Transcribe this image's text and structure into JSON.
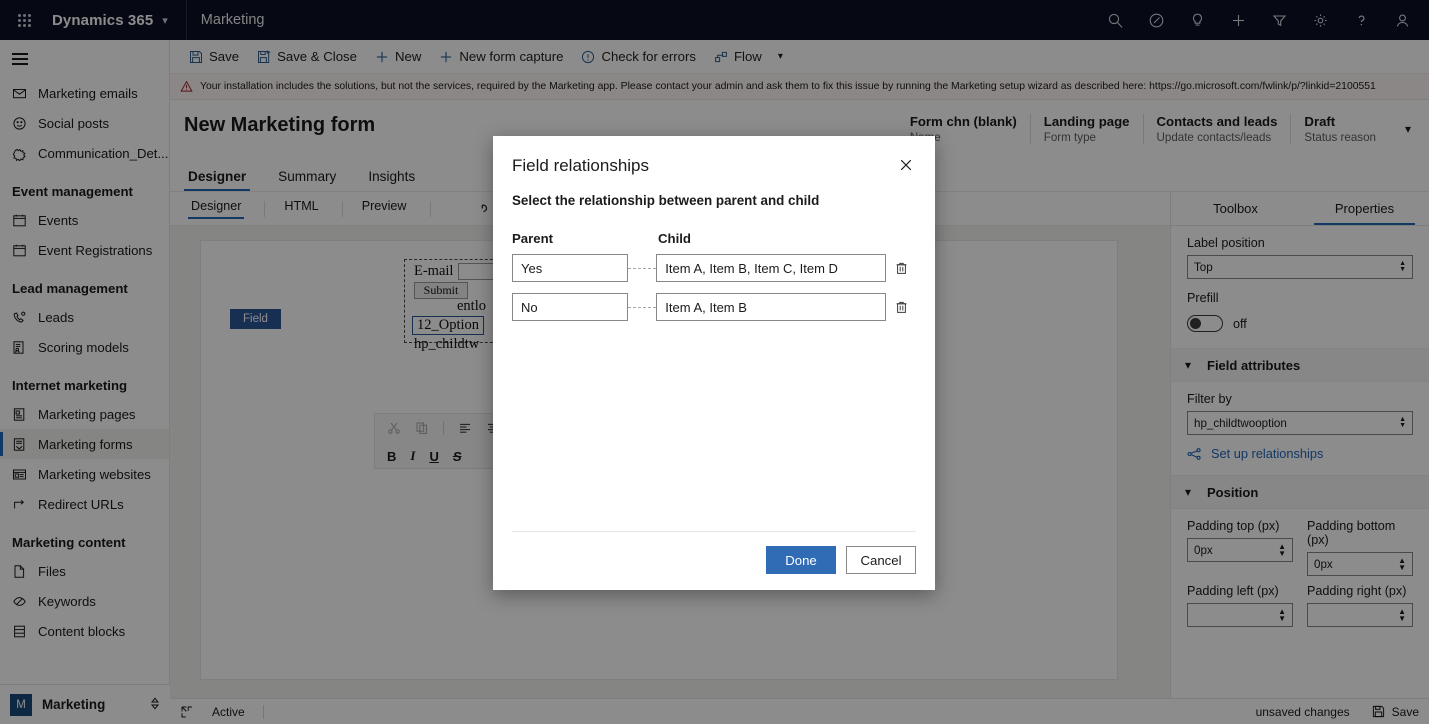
{
  "topbar": {
    "waffle_label": "app-launcher",
    "brand": "Dynamics 365",
    "app_name": "Marketing",
    "icons": [
      "search-icon",
      "assistant-icon",
      "lightbulb-icon",
      "plus-icon",
      "filter-icon",
      "gear-icon",
      "help-icon",
      "account-icon"
    ]
  },
  "sidebar": {
    "items": [
      {
        "label": "Marketing emails",
        "icon": "envelope-icon",
        "selected": false
      },
      {
        "label": "Social posts",
        "icon": "smiley-icon",
        "selected": false
      },
      {
        "label": "Communication_Det...",
        "icon": "puzzle-icon",
        "selected": false
      }
    ],
    "groups": [
      {
        "title": "Event management",
        "items": [
          {
            "label": "Events",
            "icon": "calendar-icon",
            "selected": false
          },
          {
            "label": "Event Registrations",
            "icon": "calendar-icon",
            "selected": false
          }
        ]
      },
      {
        "title": "Lead management",
        "items": [
          {
            "label": "Leads",
            "icon": "lead-icon",
            "selected": false
          },
          {
            "label": "Scoring models",
            "icon": "scoring-icon",
            "selected": false
          }
        ]
      },
      {
        "title": "Internet marketing",
        "items": [
          {
            "label": "Marketing pages",
            "icon": "page-icon",
            "selected": false
          },
          {
            "label": "Marketing forms",
            "icon": "form-icon",
            "selected": true
          },
          {
            "label": "Marketing websites",
            "icon": "website-icon",
            "selected": false
          },
          {
            "label": "Redirect URLs",
            "icon": "redirect-icon",
            "selected": false
          }
        ]
      },
      {
        "title": "Marketing content",
        "items": [
          {
            "label": "Files",
            "icon": "file-icon",
            "selected": false
          },
          {
            "label": "Keywords",
            "icon": "tag-icon",
            "selected": false
          },
          {
            "label": "Content blocks",
            "icon": "blocks-icon",
            "selected": false
          }
        ]
      }
    ],
    "area_picker": {
      "badge": "M",
      "label": "Marketing",
      "chevron": "updown-chevron-icon"
    }
  },
  "commandbar": {
    "items": [
      {
        "label": "Save",
        "icon": "save-icon"
      },
      {
        "label": "Save & Close",
        "icon": "save-close-icon"
      },
      {
        "label": "New",
        "icon": "plus-icon"
      },
      {
        "label": "New form capture",
        "icon": "plus-icon"
      },
      {
        "label": "Check for errors",
        "icon": "error-circle-icon"
      },
      {
        "label": "Flow",
        "icon": "flow-icon"
      }
    ]
  },
  "warning": {
    "icon": "warning-triangle-icon",
    "text": "Your installation includes the solutions, but not the services, required by the Marketing app. Please contact your admin and ask them to fix this issue by running the Marketing setup wizard as described here: https://go.microsoft.com/fwlink/p/?linkid=2100551"
  },
  "page": {
    "title": "New Marketing form",
    "header_fields": [
      {
        "value": "Form chn (blank)",
        "label": "Name"
      },
      {
        "value": "Landing page",
        "label": "Form type"
      },
      {
        "value": "Contacts and leads",
        "label": "Update contacts/leads"
      },
      {
        "value": "Draft",
        "label": "Status reason"
      }
    ],
    "tabs": [
      {
        "label": "Designer",
        "active": true
      },
      {
        "label": "Summary",
        "active": false
      },
      {
        "label": "Insights",
        "active": false
      }
    ]
  },
  "designer": {
    "view_tabs": [
      {
        "label": "Designer",
        "active": true
      },
      {
        "label": "HTML",
        "active": false
      },
      {
        "label": "Preview",
        "active": false
      }
    ],
    "undo_icon": "undo-icon",
    "form_preview": {
      "email_label": "E-mail",
      "submit_label": "Submit",
      "text_line": "entlo",
      "selected_field": "12_Option",
      "child_field": "hp_childtw",
      "field_badge": "Field"
    },
    "edit_toolbar": {
      "row1": [
        "cut-icon",
        "copy-icon",
        "align-left-icon",
        "align-center-icon"
      ],
      "row2": [
        "bold-icon",
        "italic-icon",
        "underline-icon",
        "strikethrough-icon"
      ]
    }
  },
  "properties": {
    "tabs": [
      {
        "label": "Toolbox",
        "active": false
      },
      {
        "label": "Properties",
        "active": true
      }
    ],
    "label_position": {
      "label": "Label position",
      "value": "Top"
    },
    "prefill": {
      "label": "Prefill",
      "state": "off"
    },
    "field_attributes": {
      "title": "Field attributes",
      "chevron": "chevron-down-icon"
    },
    "filter_by": {
      "label": "Filter by",
      "value": "hp_childtwooption"
    },
    "setup_relationships": {
      "label": "Set up relationships",
      "icon": "relationship-icon"
    },
    "position": {
      "title": "Position",
      "chevron": "chevron-down-icon"
    },
    "padding": [
      {
        "label": "Padding top (px)",
        "value": "0px"
      },
      {
        "label": "Padding bottom (px)",
        "value": "0px"
      },
      {
        "label": "Padding left (px)",
        "value": ""
      },
      {
        "label": "Padding right (px)",
        "value": ""
      }
    ]
  },
  "statusbar": {
    "popout_icon": "popout-icon",
    "status": "Active",
    "unsaved": "unsaved changes",
    "save_label": "Save",
    "save_icon": "save-icon"
  },
  "modal": {
    "title": "Field relationships",
    "close_icon": "close-icon",
    "subtitle": "Select the relationship between parent and child",
    "columns": {
      "parent": "Parent",
      "child": "Child"
    },
    "rows": [
      {
        "parent": "Yes",
        "child": "Item A, Item B, Item C, Item D",
        "delete_icon": "trash-icon"
      },
      {
        "parent": "No",
        "child": "Item A, Item B",
        "delete_icon": "trash-icon"
      }
    ],
    "done_label": "Done",
    "cancel_label": "Cancel"
  },
  "colors": {
    "topbar_bg": "#0b1023",
    "accent": "#2266bb",
    "primary_button": "#2f6cb5",
    "warning_text": "#a4262c",
    "field_badge": "#2b5797"
  }
}
